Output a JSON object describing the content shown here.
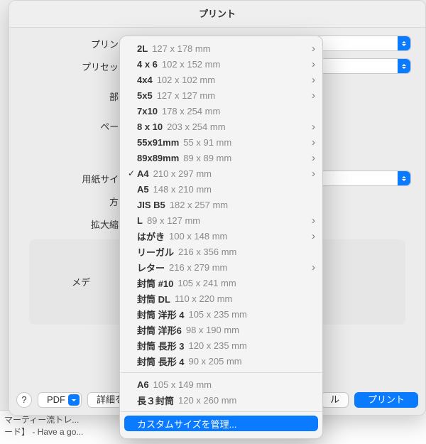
{
  "window": {
    "title": "プリント"
  },
  "labels": {
    "printer": "プリンタ",
    "preset": "プリセット",
    "copies": "部数",
    "pages": "ページ",
    "paper_size": "用紙サイズ",
    "orientation": "方向",
    "scale": "拡大縮小",
    "media": "メデ"
  },
  "buttons": {
    "help": "?",
    "pdf": "PDF",
    "details": "詳細を",
    "cancel_partial": "ル",
    "print": "プリント"
  },
  "menu": {
    "group1": [
      {
        "name": "2L",
        "dims": "127 x 178 mm",
        "submenu": true,
        "checked": false
      },
      {
        "name": "4 x 6",
        "dims": "102 x 152 mm",
        "submenu": true,
        "checked": false
      },
      {
        "name": "4x4",
        "dims": "102 x 102 mm",
        "submenu": true,
        "checked": false
      },
      {
        "name": "5x5",
        "dims": "127 x 127 mm",
        "submenu": true,
        "checked": false
      },
      {
        "name": "7x10",
        "dims": "178 x 254 mm",
        "submenu": false,
        "checked": false
      },
      {
        "name": "8 x 10",
        "dims": "203 x 254 mm",
        "submenu": true,
        "checked": false
      },
      {
        "name": "55x91mm",
        "dims": "55 x 91 mm",
        "submenu": true,
        "checked": false
      },
      {
        "name": "89x89mm",
        "dims": "89 x 89 mm",
        "submenu": true,
        "checked": false
      },
      {
        "name": "A4",
        "dims": "210 x 297 mm",
        "submenu": true,
        "checked": true
      },
      {
        "name": "A5",
        "dims": "148 x 210 mm",
        "submenu": false,
        "checked": false
      },
      {
        "name": "JIS B5",
        "dims": "182 x 257 mm",
        "submenu": false,
        "checked": false
      },
      {
        "name": "L",
        "dims": "89 x 127 mm",
        "submenu": true,
        "checked": false
      },
      {
        "name": "はがき",
        "dims": "100 x 148 mm",
        "submenu": true,
        "checked": false
      },
      {
        "name": "リーガル",
        "dims": "216 x 356 mm",
        "submenu": false,
        "checked": false
      },
      {
        "name": "レター",
        "dims": "216 x 279 mm",
        "submenu": true,
        "checked": false
      },
      {
        "name": "封筒 #10",
        "dims": "105 x 241 mm",
        "submenu": false,
        "checked": false
      },
      {
        "name": "封筒 DL",
        "dims": "110 x 220 mm",
        "submenu": false,
        "checked": false
      },
      {
        "name": "封筒 洋形 4",
        "dims": "105 x 235 mm",
        "submenu": false,
        "checked": false
      },
      {
        "name": "封筒 洋形6",
        "dims": "98 x 190 mm",
        "submenu": false,
        "checked": false
      },
      {
        "name": "封筒 長形 3",
        "dims": "120 x 235 mm",
        "submenu": false,
        "checked": false
      },
      {
        "name": "封筒 長形 4",
        "dims": "90 x 205 mm",
        "submenu": false,
        "checked": false
      }
    ],
    "group2": [
      {
        "name": "A6",
        "dims": "105 x 149 mm",
        "submenu": false,
        "checked": false
      },
      {
        "name": "長３封筒",
        "dims": "120 x 260 mm",
        "submenu": false,
        "checked": false
      }
    ],
    "manage": "カスタムサイズを管理..."
  },
  "background": {
    "line1": "マーティー流トレ...",
    "line2": "ード】 - Have a go..."
  }
}
